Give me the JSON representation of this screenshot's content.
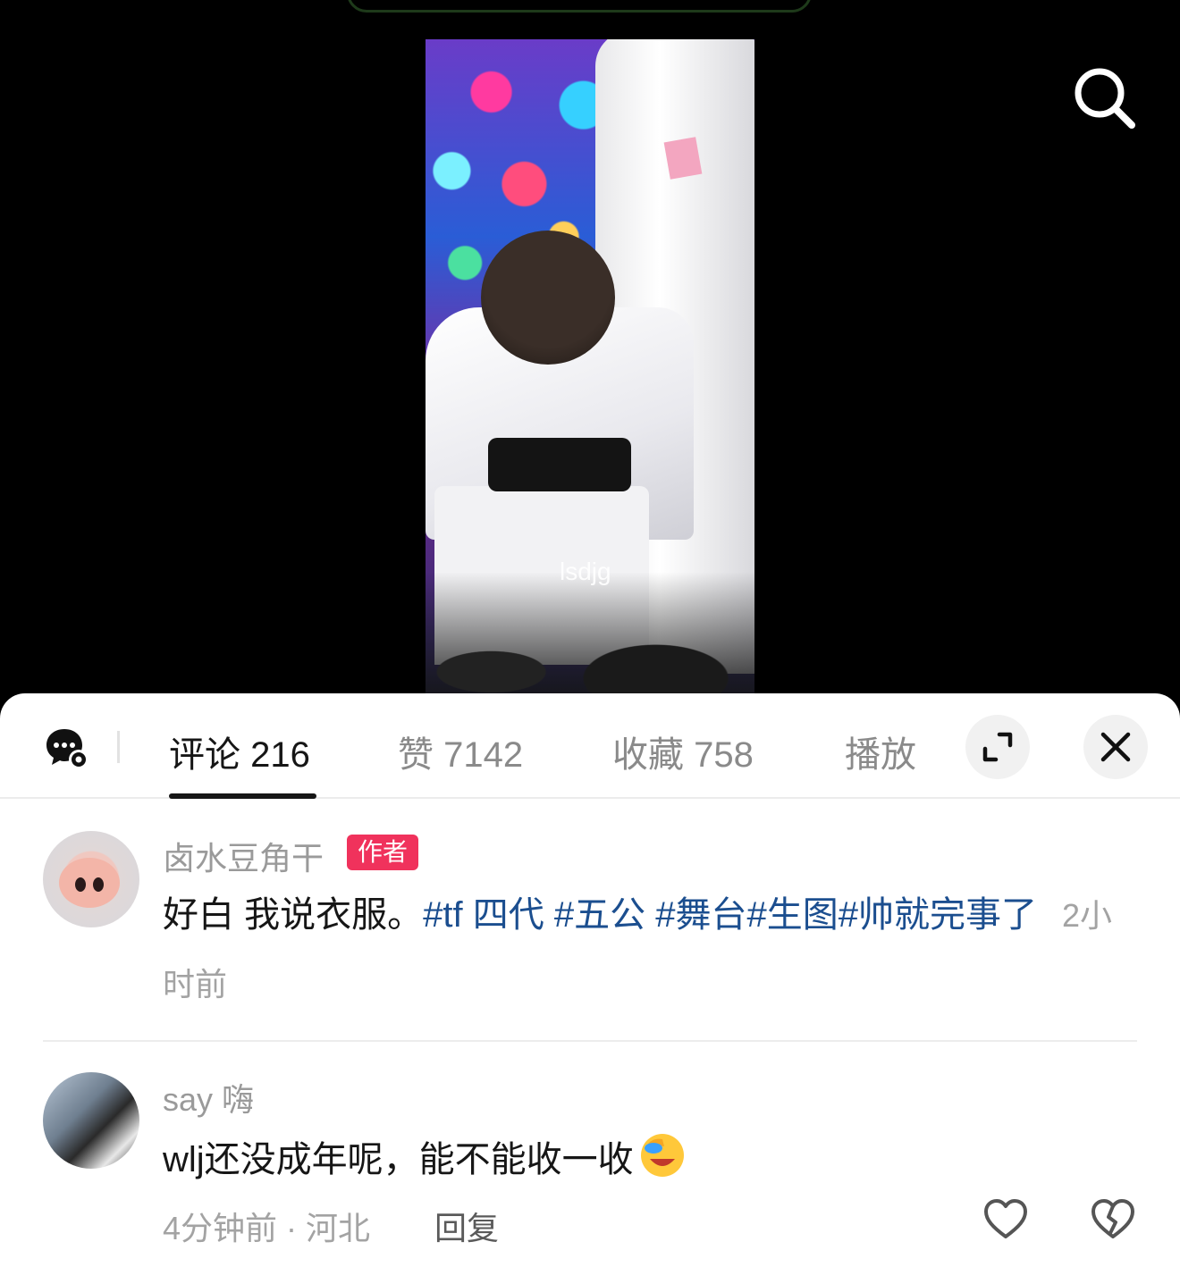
{
  "video": {
    "watermark": "lsdjg"
  },
  "tabs": [
    {
      "label": "评论 216",
      "active": true
    },
    {
      "label": "赞 7142",
      "active": false
    },
    {
      "label": "收藏 758",
      "active": false
    },
    {
      "label": "播放",
      "active": false
    }
  ],
  "comments": [
    {
      "username": "卤水豆角干",
      "badge": "作者",
      "text": "好白 我说衣服。",
      "hashtags": [
        "#tf 四代",
        "#五公",
        "#舞台",
        "#生图",
        "#帅就完事了"
      ],
      "time": "2小时前"
    },
    {
      "username": "say 嗨",
      "text": "wlj还没成年呢，能不能收一收",
      "meta": "4分钟前 · 河北",
      "reply_label": "回复"
    }
  ],
  "icons": {
    "search": "search-icon",
    "chat_settings": "chat-settings-icon",
    "expand": "expand-icon",
    "close": "close-icon",
    "like": "heart-icon",
    "dislike": "broken-heart-icon",
    "emoji": "face-palm-laugh-emoji"
  },
  "colors": {
    "accent_badge": "#f0325c",
    "hashtag": "#1b4e8f"
  }
}
